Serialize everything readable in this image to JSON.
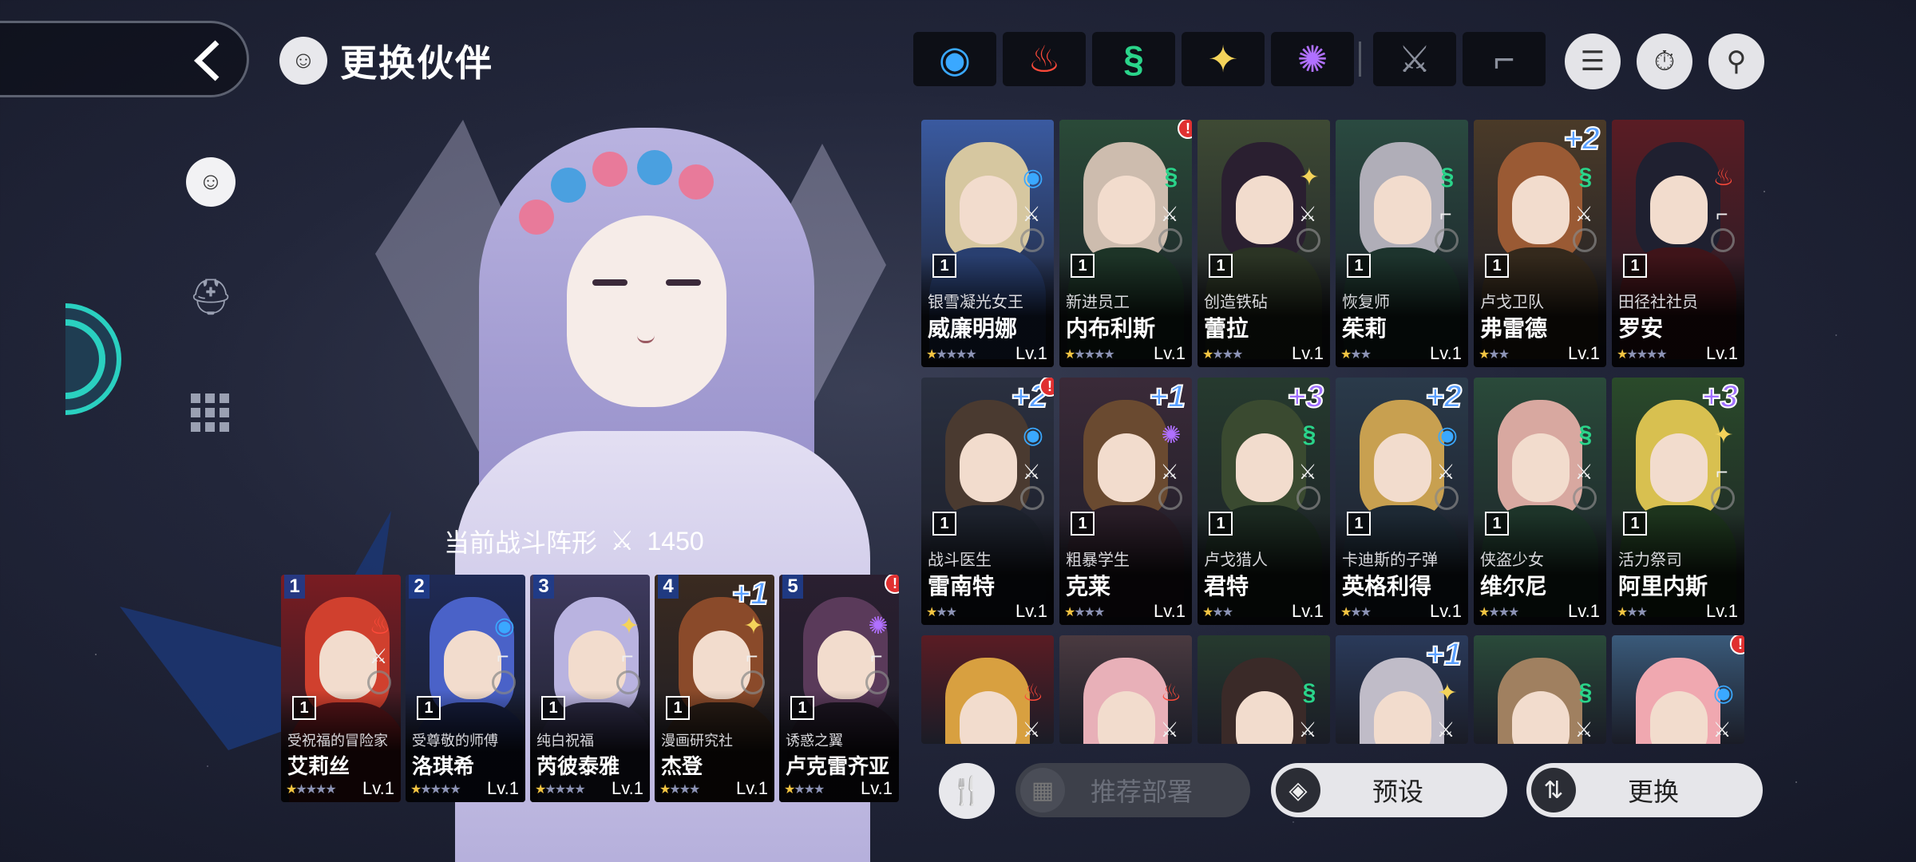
{
  "header": {
    "title": "更换伙伴"
  },
  "formation": {
    "label": "当前战斗阵形",
    "power": "1450",
    "members": [
      {
        "slot": "1",
        "title": "受祝福的冒险家",
        "name": "艾莉丝",
        "level": "Lv.1",
        "rank": "1",
        "stars_gold": 1,
        "stars_total": 5,
        "element": "fire",
        "class": "sword",
        "colors": [
          "#7a1c22",
          "#d0402e"
        ]
      },
      {
        "slot": "2",
        "title": "受尊敬的师傅",
        "name": "洛琪希",
        "level": "Lv.1",
        "rank": "1",
        "stars_gold": 1,
        "stars_total": 5,
        "element": "water",
        "class": "staff",
        "colors": [
          "#1f2a55",
          "#4a62c8"
        ]
      },
      {
        "slot": "3",
        "title": "纯白祝福",
        "name": "芮彼泰雅",
        "level": "Lv.1",
        "rank": "1",
        "stars_gold": 1,
        "stars_total": 5,
        "element": "light",
        "class": "staff",
        "colors": [
          "#3e3a5e",
          "#b9b3e0"
        ]
      },
      {
        "slot": "4",
        "title": "漫画研究社",
        "name": "杰登",
        "level": "Lv.1",
        "rank": "1",
        "stars_gold": 1,
        "stars_total": 4,
        "element": "light",
        "class": "staff",
        "plus": "+1",
        "colors": [
          "#3a2a20",
          "#8a4a2a"
        ]
      },
      {
        "slot": "5",
        "title": "诱惑之翼",
        "name": "卢克雷齐亚",
        "level": "Lv.1",
        "rank": "1",
        "stars_gold": 1,
        "stars_total": 4,
        "element": "dark",
        "class": "staff",
        "alert": "!",
        "colors": [
          "#2a1f30",
          "#5a3a5a"
        ]
      }
    ]
  },
  "filters": {
    "elements": [
      {
        "name": "water-filter-icon",
        "glyph": "◉",
        "color": "#3aa8ff"
      },
      {
        "name": "fire-filter-icon",
        "glyph": "♨",
        "color": "#ff4a3a"
      },
      {
        "name": "wind-filter-icon",
        "glyph": "§",
        "color": "#2ad48a"
      },
      {
        "name": "light-filter-icon",
        "glyph": "✦",
        "color": "#f4d35a"
      },
      {
        "name": "dark-filter-icon",
        "glyph": "✺",
        "color": "#b070ff"
      }
    ],
    "classes": [
      {
        "name": "sword-filter-icon",
        "glyph": "⚔",
        "color": "#8a8f9c"
      },
      {
        "name": "staff-filter-icon",
        "glyph": "⌐",
        "color": "#8a8f9c"
      }
    ]
  },
  "roster": [
    {
      "title": "银雪凝光女王",
      "name": "威廉明娜",
      "level": "Lv.1",
      "rank": "1",
      "stars_gold": 1,
      "stars_total": 5,
      "element": "water",
      "class": "sword",
      "colors": [
        "#3a5aa0",
        "#d6c7a0"
      ]
    },
    {
      "title": "新进员工",
      "name": "内布利斯",
      "level": "Lv.1",
      "rank": "1",
      "stars_gold": 1,
      "stars_total": 5,
      "element": "wind",
      "class": "sword",
      "alert": "!",
      "colors": [
        "#2a4a38",
        "#cdbcae"
      ]
    },
    {
      "title": "创造铁砧",
      "name": "蕾拉",
      "level": "Lv.1",
      "rank": "1",
      "stars_gold": 1,
      "stars_total": 4,
      "element": "light",
      "class": "sword",
      "colors": [
        "#3e4a34",
        "#2a1f30"
      ]
    },
    {
      "title": "恢复师",
      "name": "茱莉",
      "level": "Lv.1",
      "rank": "1",
      "stars_gold": 1,
      "stars_total": 3,
      "element": "wind",
      "class": "staff",
      "colors": [
        "#2a4a40",
        "#b0aeb8"
      ]
    },
    {
      "title": "卢戈卫队",
      "name": "弗雷德",
      "level": "Lv.1",
      "rank": "1",
      "stars_gold": 1,
      "stars_total": 3,
      "element": "wind",
      "class": "sword",
      "plus": "+2",
      "colors": [
        "#4a3a28",
        "#9a5a34"
      ]
    },
    {
      "title": "田径社社员",
      "name": "罗安",
      "level": "Lv.1",
      "rank": "1",
      "stars_gold": 1,
      "stars_total": 5,
      "element": "fire",
      "class": "staff",
      "colors": [
        "#5a1c24",
        "#1f2030"
      ]
    },
    {
      "title": "战斗医生",
      "name": "雷南特",
      "level": "Lv.1",
      "rank": "1",
      "stars_gold": 1,
      "stars_total": 3,
      "element": "water",
      "class": "sword",
      "plus": "+2",
      "alert": "!",
      "colors": [
        "#2a3040",
        "#4a3a30"
      ]
    },
    {
      "title": "粗暴学生",
      "name": "克莱",
      "level": "Lv.1",
      "rank": "1",
      "stars_gold": 1,
      "stars_total": 4,
      "element": "dark",
      "class": "sword",
      "plus": "+1",
      "colors": [
        "#3a2a38",
        "#6a4a30"
      ]
    },
    {
      "title": "卢戈猎人",
      "name": "君特",
      "level": "Lv.1",
      "rank": "1",
      "stars_gold": 1,
      "stars_total": 3,
      "element": "wind",
      "class": "sword",
      "plus": "+3",
      "colors": [
        "#263a2e",
        "#3a4a30"
      ]
    },
    {
      "title": "卡迪斯的子弹",
      "name": "英格利得",
      "level": "Lv.1",
      "rank": "1",
      "stars_gold": 1,
      "stars_total": 3,
      "element": "water",
      "class": "sword",
      "plus": "+2",
      "colors": [
        "#2a3a4a",
        "#c8a050"
      ]
    },
    {
      "title": "侠盗少女",
      "name": "维尔尼",
      "level": "Lv.1",
      "rank": "1",
      "stars_gold": 1,
      "stars_total": 4,
      "element": "wind",
      "class": "sword",
      "colors": [
        "#2a4a3a",
        "#d8a8a0"
      ]
    },
    {
      "title": "活力祭司",
      "name": "阿里内斯",
      "level": "Lv.1",
      "rank": "1",
      "stars_gold": 1,
      "stars_total": 3,
      "element": "light",
      "class": "staff",
      "plus": "+3",
      "colors": [
        "#2a4a2a",
        "#d8c050"
      ]
    },
    {
      "title": "",
      "name": "",
      "level": "",
      "rank": "",
      "stars_gold": 0,
      "stars_total": 0,
      "element": "fire",
      "class": "sword",
      "colors": [
        "#5a1c24",
        "#d8a040"
      ]
    },
    {
      "title": "",
      "name": "",
      "level": "",
      "rank": "",
      "stars_gold": 0,
      "stars_total": 0,
      "element": "fire",
      "class": "sword",
      "colors": [
        "#4a3a40",
        "#e8b0b8"
      ]
    },
    {
      "title": "",
      "name": "",
      "level": "",
      "rank": "",
      "stars_gold": 0,
      "stars_total": 0,
      "element": "wind",
      "class": "sword",
      "colors": [
        "#263a2e",
        "#3a2a28"
      ]
    },
    {
      "title": "",
      "name": "",
      "level": "",
      "rank": "",
      "stars_gold": 0,
      "stars_total": 0,
      "element": "light",
      "class": "sword",
      "plus": "+1",
      "colors": [
        "#2a3a5a",
        "#c0bcc8"
      ]
    },
    {
      "title": "",
      "name": "",
      "level": "",
      "rank": "",
      "stars_gold": 0,
      "stars_total": 0,
      "element": "wind",
      "class": "sword",
      "colors": [
        "#2a4a3a",
        "#a08060"
      ]
    },
    {
      "title": "",
      "name": "",
      "level": "",
      "rank": "",
      "stars_gold": 0,
      "stars_total": 0,
      "element": "water",
      "class": "sword",
      "alert": "!",
      "colors": [
        "#3a5a7a",
        "#f0a8b0"
      ]
    }
  ],
  "bottom": {
    "recommend_label": "推荐部署",
    "preset_label": "预设",
    "change_label": "更换"
  },
  "colors": {
    "water": "#3aa8ff",
    "fire": "#ff4a3a",
    "wind": "#2ad48a",
    "light": "#f4d35a",
    "dark": "#b070ff"
  },
  "element_glyphs": {
    "water": "◉",
    "fire": "♨",
    "wind": "§",
    "light": "✦",
    "dark": "✺"
  },
  "class_glyphs": {
    "sword": "⚔",
    "staff": "⌐"
  }
}
